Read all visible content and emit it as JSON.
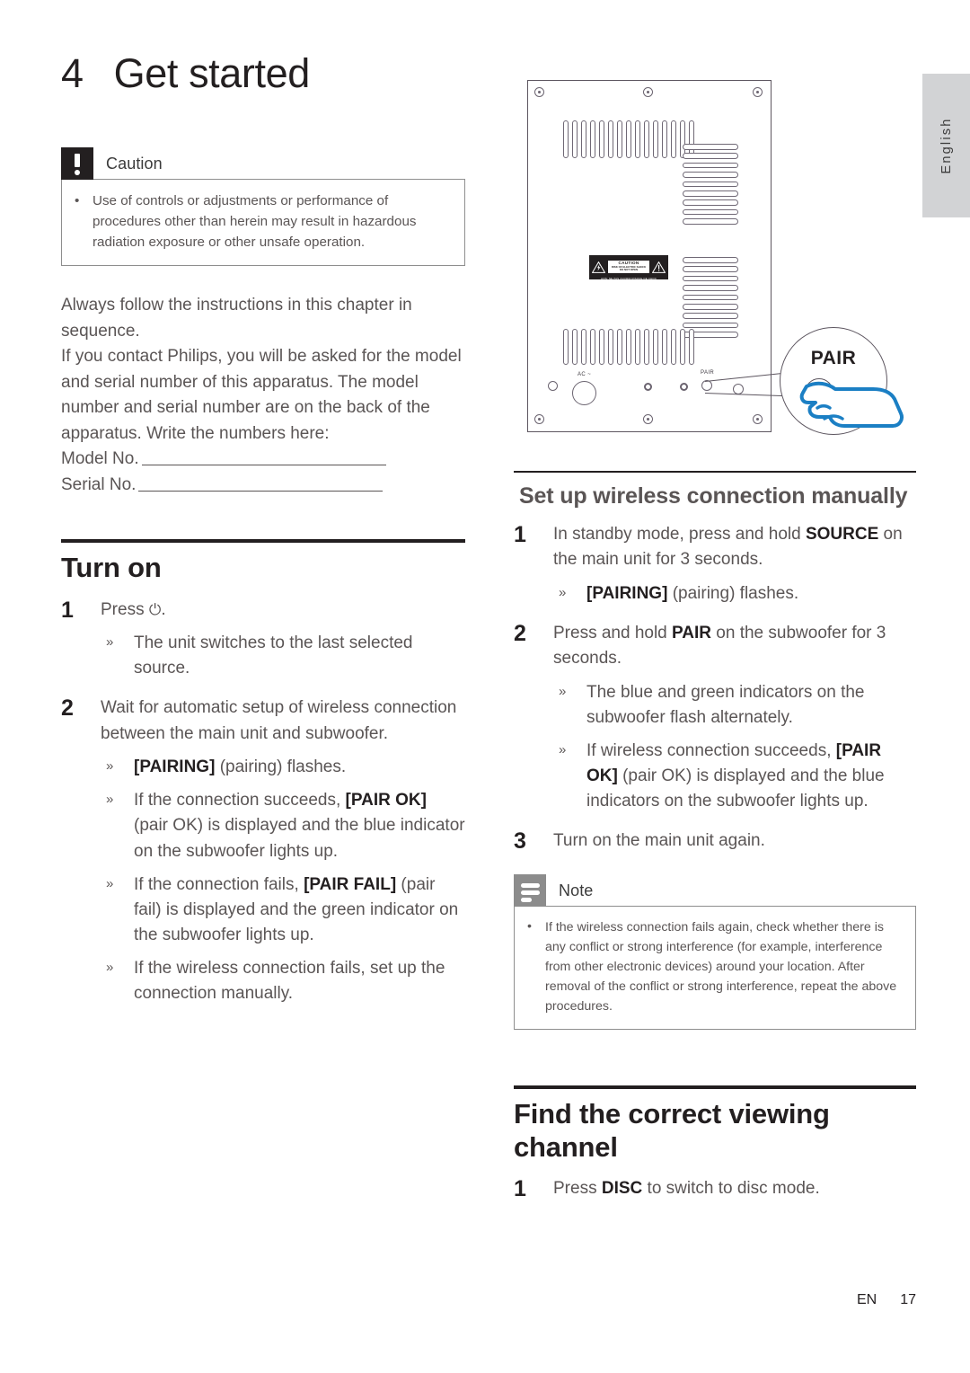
{
  "page": {
    "language_tab": "English",
    "footer_locale": "EN",
    "footer_page": "17"
  },
  "chapter": {
    "number": "4",
    "title": "Get started"
  },
  "caution_box": {
    "icon": "exclamation-icon",
    "title": "Caution",
    "items": [
      "Use of controls or adjustments or performance of procedures other than herein may result in hazardous radiation exposure or other unsafe operation."
    ]
  },
  "intro": {
    "paragraph_1": "Always follow the instructions in this chapter in sequence.",
    "paragraph_2": "If you contact Philips, you will be asked for the model and serial number of this apparatus. The model number and serial number are on the back of the apparatus. Write the numbers here:",
    "model_label": "Model No.",
    "serial_label": "Serial No."
  },
  "turn_on": {
    "heading": "Turn on",
    "steps": [
      {
        "number": "1",
        "text_before": "Press ",
        "icon": "power-icon",
        "icon_glyph": "⏻",
        "text_after": ".",
        "sub_items": [
          {
            "marker": "»",
            "text": "The unit switches to the last selected source."
          }
        ]
      },
      {
        "number": "2",
        "text_before": "Wait for automatic setup of wireless connection between the main unit and subwoofer.",
        "icon": "",
        "icon_glyph": "",
        "text_after": "",
        "sub_items": [
          {
            "marker": "»",
            "bold": "[PAIRING]",
            "text": " (pairing) flashes."
          },
          {
            "marker": "»",
            "text_pre": "If the connection succeeds, ",
            "bold": "[PAIR OK]",
            "text": " (pair OK) is displayed and the blue indicator on the subwoofer lights up."
          },
          {
            "marker": "»",
            "text_pre": "If the connection fails, ",
            "bold": "[PAIR FAIL]",
            "text": " (pair fail) is displayed and the green indicator on the subwoofer lights up."
          },
          {
            "marker": "»",
            "text": "If the wireless connection fails, set up the connection manually."
          }
        ]
      }
    ]
  },
  "illustration": {
    "name": "subwoofer-rear-panel-diagram",
    "caution_label": {
      "title": "CAUTION",
      "line_1": "RISK OF ELECTRIC SHOCK",
      "line_2": "DO NOT OPEN",
      "line_3": "AVIS: NE PAS OUVRIR RISQUE DE CHOC ELECTRIQUE"
    },
    "ac_label": "AC ~",
    "pair_small_label": "PAIR",
    "callout_label": "PAIR",
    "hand_color": "#1b7fc4"
  },
  "manual_setup": {
    "heading": "Set up wireless connection manually",
    "steps": [
      {
        "number": "1",
        "text_pre": "In standby mode, press and hold ",
        "bold": "SOURCE",
        "text_post": " on the main unit for 3 seconds.",
        "sub_items": [
          {
            "marker": "»",
            "bold": "[PAIRING]",
            "text": " (pairing) flashes."
          }
        ]
      },
      {
        "number": "2",
        "text_pre": "Press and hold ",
        "bold": "PAIR",
        "text_post": " on the subwoofer for 3 seconds.",
        "sub_items": [
          {
            "marker": "»",
            "text": "The blue and green indicators on the subwoofer flash alternately."
          },
          {
            "marker": "»",
            "text_pre": "If wireless connection succeeds, ",
            "bold": "[PAIR OK]",
            "text": " (pair OK) is displayed and the blue indicators on the subwoofer lights up."
          }
        ]
      },
      {
        "number": "3",
        "text_pre": "Turn on the main unit again.",
        "bold": "",
        "text_post": "",
        "sub_items": []
      }
    ]
  },
  "note_box": {
    "icon": "note-lines-icon",
    "title": "Note",
    "items": [
      "If the wireless connection fails again, check whether there is any conflict or strong interference (for example, interference from other electronic devices) around your location. After removal of the conflict or strong interference, repeat the above procedures."
    ]
  },
  "viewing_channel": {
    "heading": "Find the correct viewing channel",
    "steps": [
      {
        "number": "1",
        "text_pre": "Press ",
        "bold": "DISC",
        "text_post": " to switch to disc mode."
      }
    ]
  }
}
